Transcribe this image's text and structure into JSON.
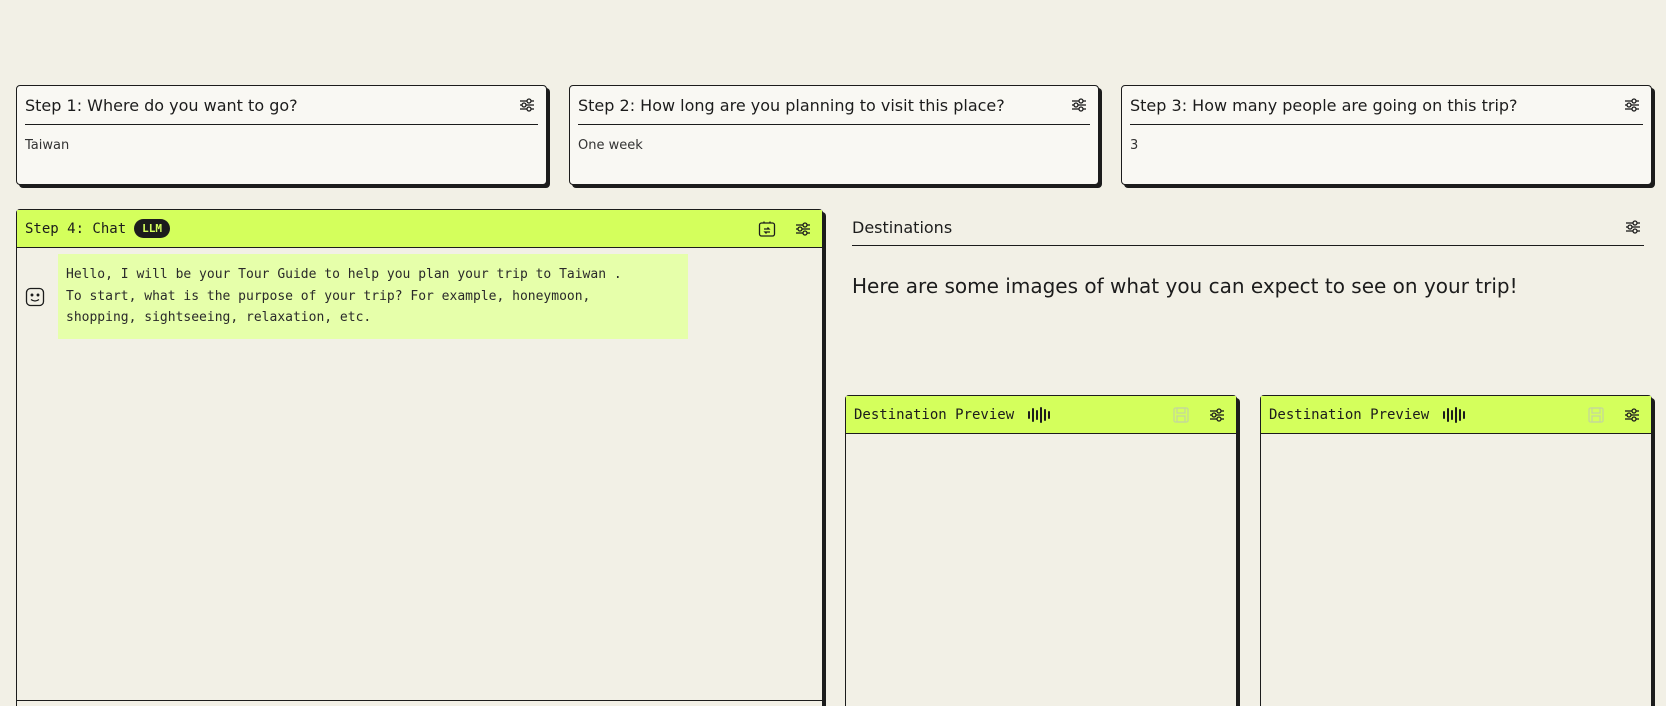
{
  "steps": [
    {
      "title": "Step 1: Where do you want to go?",
      "value": "Taiwan"
    },
    {
      "title": "Step 2: How long are you planning to visit this place?",
      "value": "One week"
    },
    {
      "title": "Step 3: How many people are going on this trip?",
      "value": "3"
    }
  ],
  "chat": {
    "title": "Step 4: Chat",
    "badge": "LLM",
    "message": "Hello, I will be your Tour Guide to help you plan your trip to Taiwan .\nTo start, what is the purpose of your trip? For example, honeymoon,\nshopping, sightseeing, relaxation, etc."
  },
  "destinations": {
    "title": "Destinations",
    "text": "Here are some images of what you can expect to see on your trip!"
  },
  "previews": [
    {
      "title": "Destination Preview"
    },
    {
      "title": "Destination Preview"
    }
  ],
  "colors": {
    "accent": "#d4ff5c",
    "bubble": "#e6ffaa",
    "background": "#f2f0e6",
    "card": "#f9f8f3",
    "ink": "#1c1c1c"
  },
  "icons": {
    "settings": "sliders-icon",
    "rerun": "rerun-icon",
    "bot": "bot-face-icon",
    "audio": "waveform-icon",
    "save": "save-icon"
  }
}
